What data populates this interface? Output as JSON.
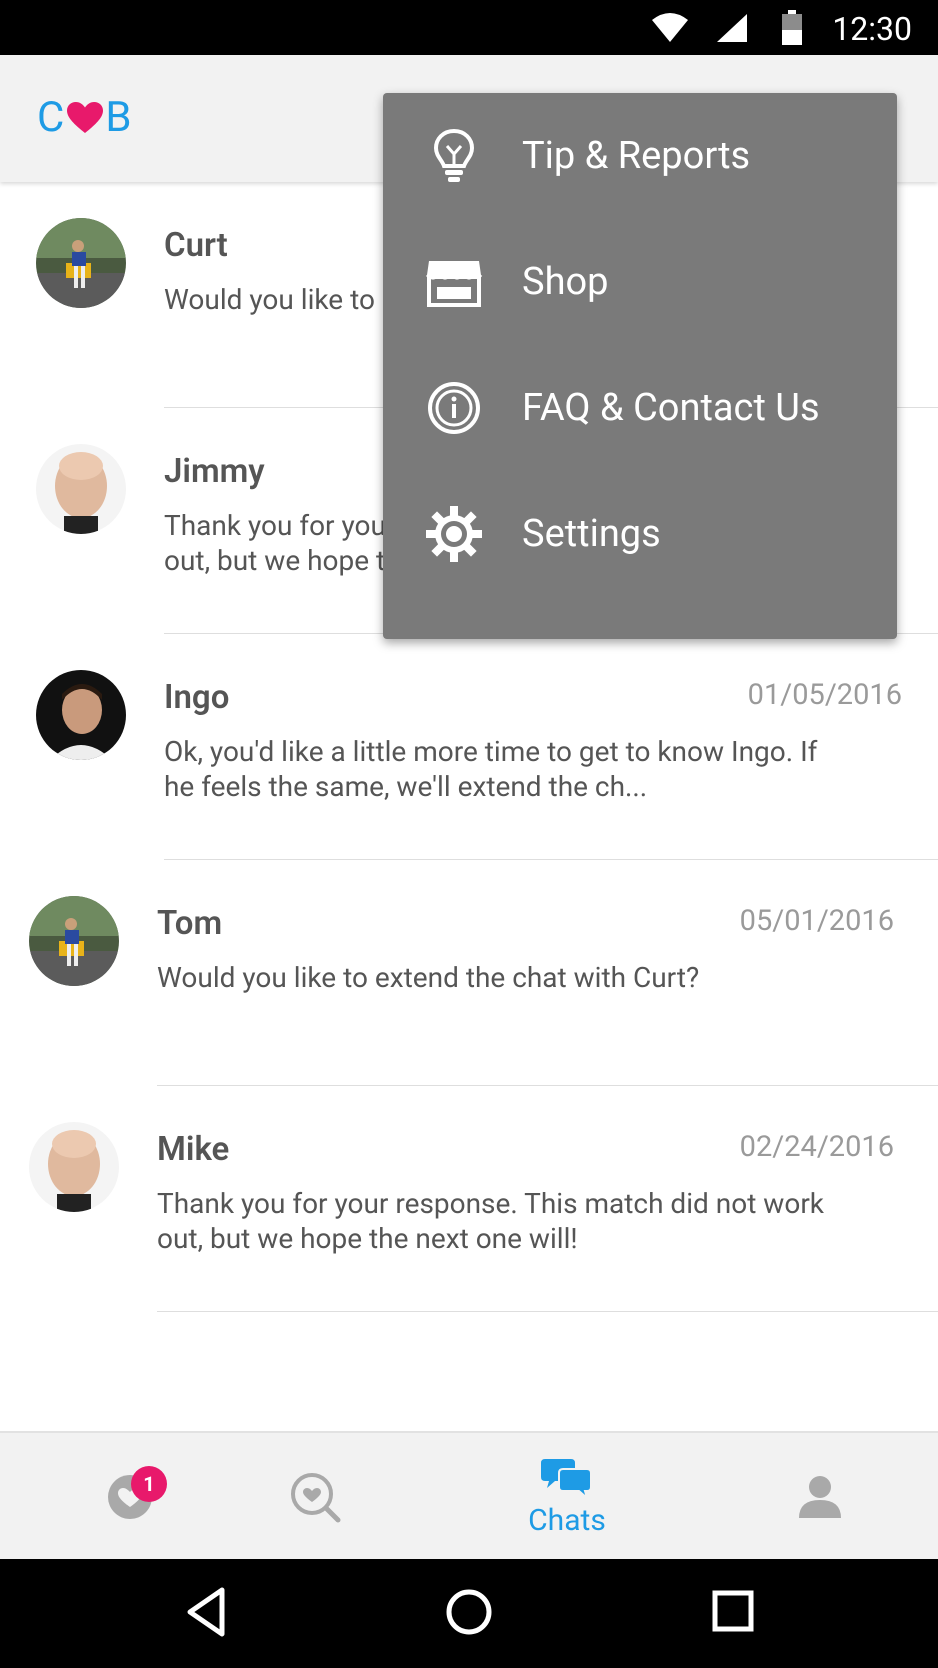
{
  "status_bar": {
    "time": "12:30"
  },
  "app": {
    "logo_left": "C",
    "logo_right": "B"
  },
  "menu": {
    "items": [
      {
        "label": "Tip & Reports",
        "icon": "lightbulb-icon"
      },
      {
        "label": "Shop",
        "icon": "shop-icon"
      },
      {
        "label": "FAQ & Contact Us",
        "icon": "info-icon"
      },
      {
        "label": "Settings",
        "icon": "gear-icon"
      }
    ]
  },
  "chats": [
    {
      "name": "Curt",
      "date": "",
      "message": "Would you like to extend the chat with Curt?"
    },
    {
      "name": "Jimmy",
      "date": "",
      "message": "Thank you for your response. This match did not work out, but we hope the next one will!"
    },
    {
      "name": "Ingo",
      "date": "01/05/2016",
      "message": "Ok, you'd like a little more time to get to know Ingo. If he feels the same, we'll extend the ch..."
    },
    {
      "name": "Tom",
      "date": "05/01/2016",
      "message": "Would you like to extend the chat with Curt?"
    },
    {
      "name": "Mike",
      "date": "02/24/2016",
      "message": "Thank you for your response. This match did not work out, but we hope the next one will!"
    }
  ],
  "bottom_nav": {
    "badge_count": "1",
    "chats_label": "Chats",
    "accent": "#1e9be5",
    "badge_color": "#e8196b"
  }
}
